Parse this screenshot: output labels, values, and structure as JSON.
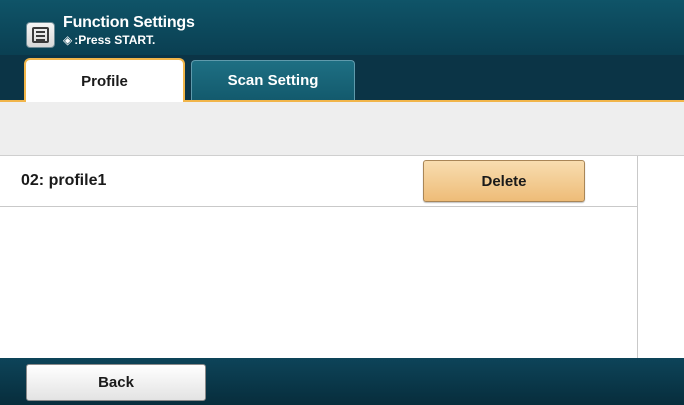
{
  "header": {
    "title": "Function Settings",
    "hint_icon": "start-diamond-icon",
    "hint": ":Press START.",
    "menu_icon": "list-menu-icon"
  },
  "tabs": [
    {
      "label": "Profile",
      "active": true
    },
    {
      "label": "Scan Setting",
      "active": false
    }
  ],
  "list": {
    "items": [
      {
        "label": "02: profile1",
        "action_label": "Delete"
      }
    ]
  },
  "footer": {
    "back_label": "Back"
  },
  "colors": {
    "header_bg": "#0f5468",
    "tab_accent": "#f1b54a",
    "delete_button": "#f2c989"
  }
}
